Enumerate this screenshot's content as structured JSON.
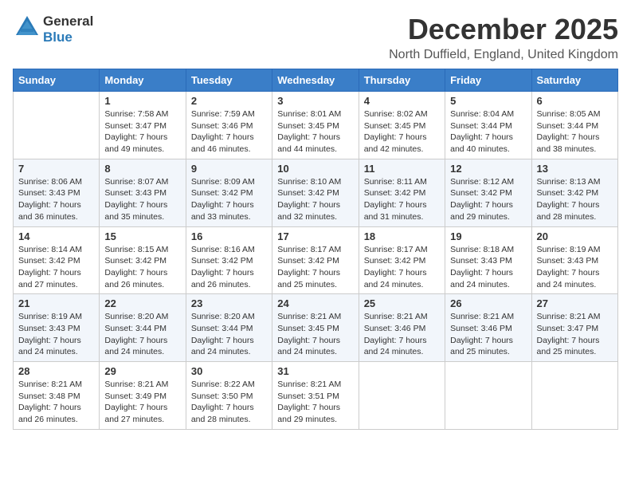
{
  "header": {
    "logo_general": "General",
    "logo_blue": "Blue",
    "month_title": "December 2025",
    "location": "North Duffield, England, United Kingdom"
  },
  "days_of_week": [
    "Sunday",
    "Monday",
    "Tuesday",
    "Wednesday",
    "Thursday",
    "Friday",
    "Saturday"
  ],
  "weeks": [
    [
      {
        "day": "",
        "sunrise": "",
        "sunset": "",
        "daylight": ""
      },
      {
        "day": "1",
        "sunrise": "Sunrise: 7:58 AM",
        "sunset": "Sunset: 3:47 PM",
        "daylight": "Daylight: 7 hours and 49 minutes."
      },
      {
        "day": "2",
        "sunrise": "Sunrise: 7:59 AM",
        "sunset": "Sunset: 3:46 PM",
        "daylight": "Daylight: 7 hours and 46 minutes."
      },
      {
        "day": "3",
        "sunrise": "Sunrise: 8:01 AM",
        "sunset": "Sunset: 3:45 PM",
        "daylight": "Daylight: 7 hours and 44 minutes."
      },
      {
        "day": "4",
        "sunrise": "Sunrise: 8:02 AM",
        "sunset": "Sunset: 3:45 PM",
        "daylight": "Daylight: 7 hours and 42 minutes."
      },
      {
        "day": "5",
        "sunrise": "Sunrise: 8:04 AM",
        "sunset": "Sunset: 3:44 PM",
        "daylight": "Daylight: 7 hours and 40 minutes."
      },
      {
        "day": "6",
        "sunrise": "Sunrise: 8:05 AM",
        "sunset": "Sunset: 3:44 PM",
        "daylight": "Daylight: 7 hours and 38 minutes."
      }
    ],
    [
      {
        "day": "7",
        "sunrise": "Sunrise: 8:06 AM",
        "sunset": "Sunset: 3:43 PM",
        "daylight": "Daylight: 7 hours and 36 minutes."
      },
      {
        "day": "8",
        "sunrise": "Sunrise: 8:07 AM",
        "sunset": "Sunset: 3:43 PM",
        "daylight": "Daylight: 7 hours and 35 minutes."
      },
      {
        "day": "9",
        "sunrise": "Sunrise: 8:09 AM",
        "sunset": "Sunset: 3:42 PM",
        "daylight": "Daylight: 7 hours and 33 minutes."
      },
      {
        "day": "10",
        "sunrise": "Sunrise: 8:10 AM",
        "sunset": "Sunset: 3:42 PM",
        "daylight": "Daylight: 7 hours and 32 minutes."
      },
      {
        "day": "11",
        "sunrise": "Sunrise: 8:11 AM",
        "sunset": "Sunset: 3:42 PM",
        "daylight": "Daylight: 7 hours and 31 minutes."
      },
      {
        "day": "12",
        "sunrise": "Sunrise: 8:12 AM",
        "sunset": "Sunset: 3:42 PM",
        "daylight": "Daylight: 7 hours and 29 minutes."
      },
      {
        "day": "13",
        "sunrise": "Sunrise: 8:13 AM",
        "sunset": "Sunset: 3:42 PM",
        "daylight": "Daylight: 7 hours and 28 minutes."
      }
    ],
    [
      {
        "day": "14",
        "sunrise": "Sunrise: 8:14 AM",
        "sunset": "Sunset: 3:42 PM",
        "daylight": "Daylight: 7 hours and 27 minutes."
      },
      {
        "day": "15",
        "sunrise": "Sunrise: 8:15 AM",
        "sunset": "Sunset: 3:42 PM",
        "daylight": "Daylight: 7 hours and 26 minutes."
      },
      {
        "day": "16",
        "sunrise": "Sunrise: 8:16 AM",
        "sunset": "Sunset: 3:42 PM",
        "daylight": "Daylight: 7 hours and 26 minutes."
      },
      {
        "day": "17",
        "sunrise": "Sunrise: 8:17 AM",
        "sunset": "Sunset: 3:42 PM",
        "daylight": "Daylight: 7 hours and 25 minutes."
      },
      {
        "day": "18",
        "sunrise": "Sunrise: 8:17 AM",
        "sunset": "Sunset: 3:42 PM",
        "daylight": "Daylight: 7 hours and 24 minutes."
      },
      {
        "day": "19",
        "sunrise": "Sunrise: 8:18 AM",
        "sunset": "Sunset: 3:43 PM",
        "daylight": "Daylight: 7 hours and 24 minutes."
      },
      {
        "day": "20",
        "sunrise": "Sunrise: 8:19 AM",
        "sunset": "Sunset: 3:43 PM",
        "daylight": "Daylight: 7 hours and 24 minutes."
      }
    ],
    [
      {
        "day": "21",
        "sunrise": "Sunrise: 8:19 AM",
        "sunset": "Sunset: 3:43 PM",
        "daylight": "Daylight: 7 hours and 24 minutes."
      },
      {
        "day": "22",
        "sunrise": "Sunrise: 8:20 AM",
        "sunset": "Sunset: 3:44 PM",
        "daylight": "Daylight: 7 hours and 24 minutes."
      },
      {
        "day": "23",
        "sunrise": "Sunrise: 8:20 AM",
        "sunset": "Sunset: 3:44 PM",
        "daylight": "Daylight: 7 hours and 24 minutes."
      },
      {
        "day": "24",
        "sunrise": "Sunrise: 8:21 AM",
        "sunset": "Sunset: 3:45 PM",
        "daylight": "Daylight: 7 hours and 24 minutes."
      },
      {
        "day": "25",
        "sunrise": "Sunrise: 8:21 AM",
        "sunset": "Sunset: 3:46 PM",
        "daylight": "Daylight: 7 hours and 24 minutes."
      },
      {
        "day": "26",
        "sunrise": "Sunrise: 8:21 AM",
        "sunset": "Sunset: 3:46 PM",
        "daylight": "Daylight: 7 hours and 25 minutes."
      },
      {
        "day": "27",
        "sunrise": "Sunrise: 8:21 AM",
        "sunset": "Sunset: 3:47 PM",
        "daylight": "Daylight: 7 hours and 25 minutes."
      }
    ],
    [
      {
        "day": "28",
        "sunrise": "Sunrise: 8:21 AM",
        "sunset": "Sunset: 3:48 PM",
        "daylight": "Daylight: 7 hours and 26 minutes."
      },
      {
        "day": "29",
        "sunrise": "Sunrise: 8:21 AM",
        "sunset": "Sunset: 3:49 PM",
        "daylight": "Daylight: 7 hours and 27 minutes."
      },
      {
        "day": "30",
        "sunrise": "Sunrise: 8:22 AM",
        "sunset": "Sunset: 3:50 PM",
        "daylight": "Daylight: 7 hours and 28 minutes."
      },
      {
        "day": "31",
        "sunrise": "Sunrise: 8:21 AM",
        "sunset": "Sunset: 3:51 PM",
        "daylight": "Daylight: 7 hours and 29 minutes."
      },
      {
        "day": "",
        "sunrise": "",
        "sunset": "",
        "daylight": ""
      },
      {
        "day": "",
        "sunrise": "",
        "sunset": "",
        "daylight": ""
      },
      {
        "day": "",
        "sunrise": "",
        "sunset": "",
        "daylight": ""
      }
    ]
  ]
}
